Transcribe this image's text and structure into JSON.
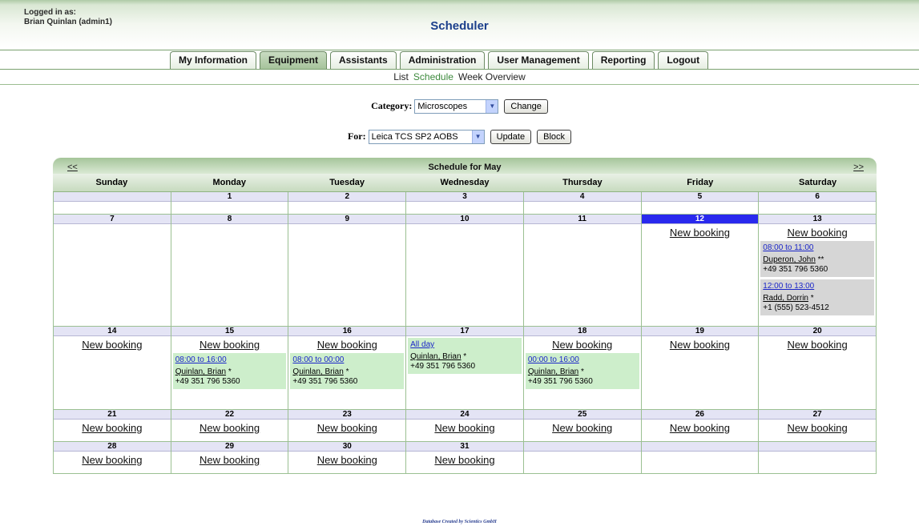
{
  "header": {
    "login_label": "Logged in as:",
    "user": "Brian Quinlan (admin1)",
    "app_title": "Scheduler"
  },
  "tabs": [
    {
      "label": "My Information",
      "active": false
    },
    {
      "label": "Equipment",
      "active": true
    },
    {
      "label": "Assistants",
      "active": false
    },
    {
      "label": "Administration",
      "active": false
    },
    {
      "label": "User Management",
      "active": false
    },
    {
      "label": "Reporting",
      "active": false
    },
    {
      "label": "Logout",
      "active": false
    }
  ],
  "subnav": [
    {
      "label": "List",
      "selected": false
    },
    {
      "label": "Schedule",
      "selected": true
    },
    {
      "label": "Week Overview",
      "selected": false
    }
  ],
  "category_form": {
    "label": "Category:",
    "value": "Microscopes",
    "button": "Change"
  },
  "for_form": {
    "label": "For:",
    "value": "Leica TCS SP2 AOBS",
    "update_button": "Update",
    "block_button": "Block"
  },
  "calendar": {
    "title": "Schedule for May",
    "prev": "<<",
    "next": ">>",
    "weekdays": [
      "Sunday",
      "Monday",
      "Tuesday",
      "Wednesday",
      "Thursday",
      "Friday",
      "Saturday"
    ],
    "new_booking_label": "New booking",
    "weeks": [
      [
        {
          "date": ""
        },
        {
          "date": "1"
        },
        {
          "date": "2"
        },
        {
          "date": "3"
        },
        {
          "date": "4"
        },
        {
          "date": "5"
        },
        {
          "date": "6"
        }
      ],
      [
        {
          "date": "7"
        },
        {
          "date": "8"
        },
        {
          "date": "9"
        },
        {
          "date": "10"
        },
        {
          "date": "11"
        },
        {
          "date": "12",
          "today": true,
          "new_booking": true
        },
        {
          "date": "13",
          "new_booking": true,
          "bookings": [
            {
              "time": "08:00 to 11:00",
              "name": "Duperon, John",
              "mark": " **",
              "phone": "+49 351 796 5360",
              "color": "grey"
            },
            {
              "time": "12:00 to 13:00",
              "name": "Radd, Dorrin",
              "mark": " *",
              "phone": "+1 (555) 523-4512",
              "color": "grey"
            }
          ]
        }
      ],
      [
        {
          "date": "14",
          "new_booking": true
        },
        {
          "date": "15",
          "new_booking": true,
          "bookings": [
            {
              "time": "08:00 to 16:00",
              "name": "Quinlan, Brian",
              "mark": " *",
              "phone": "+49 351 796 5360",
              "color": "green"
            }
          ]
        },
        {
          "date": "16",
          "new_booking": true,
          "bookings": [
            {
              "time": "08:00 to 00:00",
              "name": "Quinlan, Brian",
              "mark": " *",
              "phone": "+49 351 796 5360",
              "color": "green"
            }
          ]
        },
        {
          "date": "17",
          "new_booking": false,
          "bookings": [
            {
              "time": "All day",
              "name": "Quinlan, Brian",
              "mark": " *",
              "phone": "+49 351 796 5360",
              "color": "green"
            }
          ]
        },
        {
          "date": "18",
          "new_booking": true,
          "bookings": [
            {
              "time": "00:00 to 16:00",
              "name": "Quinlan, Brian",
              "mark": " *",
              "phone": "+49 351 796 5360",
              "color": "green"
            }
          ]
        },
        {
          "date": "19",
          "new_booking": true
        },
        {
          "date": "20",
          "new_booking": true
        }
      ],
      [
        {
          "date": "21",
          "new_booking": true
        },
        {
          "date": "22",
          "new_booking": true
        },
        {
          "date": "23",
          "new_booking": true
        },
        {
          "date": "24",
          "new_booking": true
        },
        {
          "date": "25",
          "new_booking": true
        },
        {
          "date": "26",
          "new_booking": true
        },
        {
          "date": "27",
          "new_booking": true
        }
      ],
      [
        {
          "date": "28",
          "new_booking": true
        },
        {
          "date": "29",
          "new_booking": true
        },
        {
          "date": "30",
          "new_booking": true
        },
        {
          "date": "31",
          "new_booking": true
        },
        {
          "date": ""
        },
        {
          "date": ""
        },
        {
          "date": ""
        }
      ]
    ]
  },
  "footer": "Database Created by Scientics GmbH",
  "colors": {
    "accent_green": "#a6c39b",
    "today_blue": "#2929ee",
    "link_blue": "#1a25c8",
    "booking_green": "#cdeecb",
    "booking_grey": "#d6d6d6"
  }
}
